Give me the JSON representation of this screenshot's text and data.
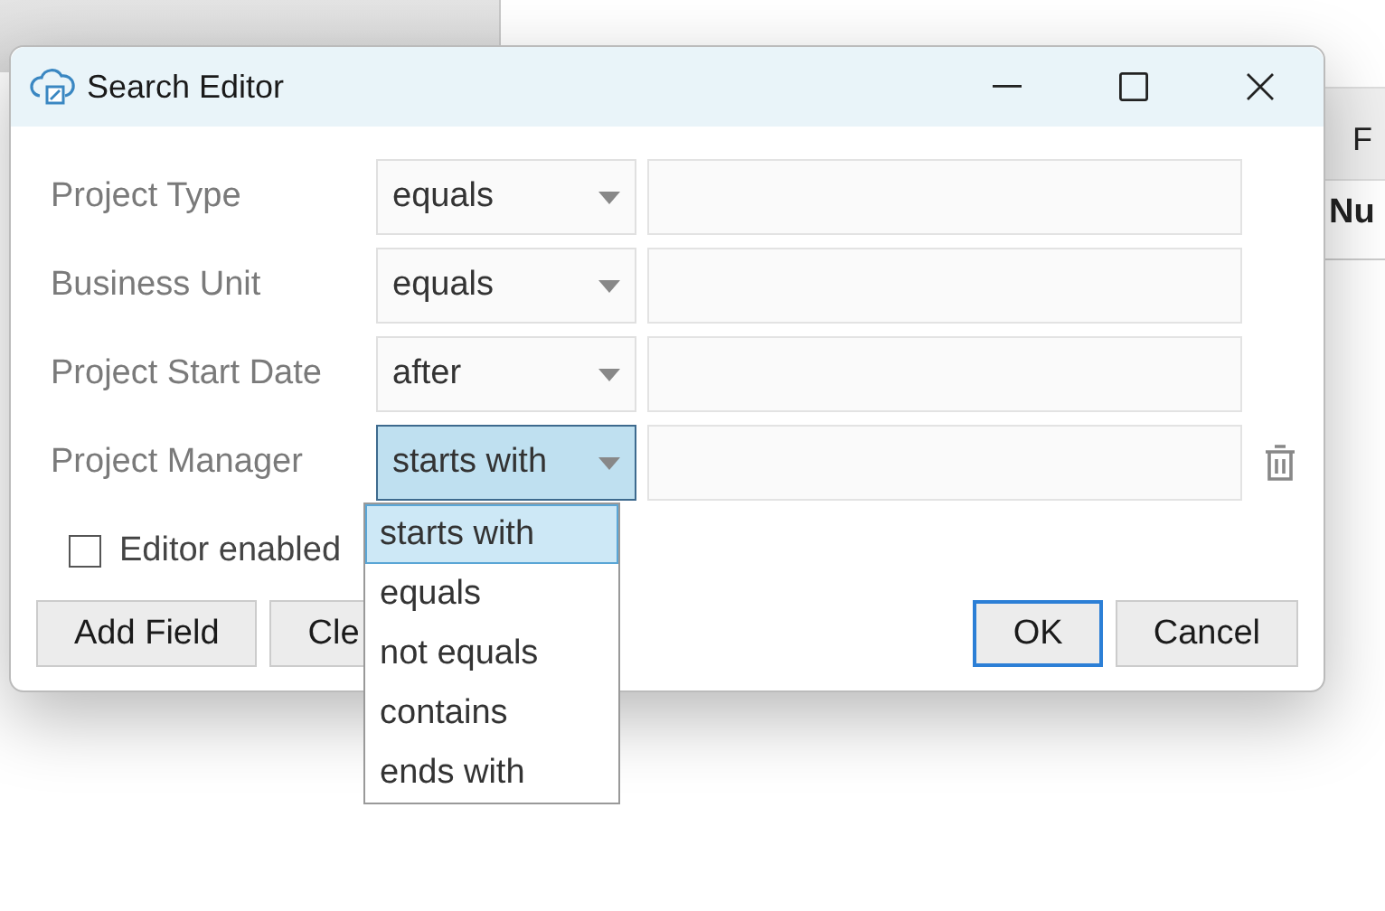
{
  "background_table": {
    "column_header": "F",
    "header_cell": "Nu"
  },
  "dialog": {
    "title": "Search Editor",
    "rows": [
      {
        "label": "Project Type",
        "operator": "equals",
        "focused": false,
        "show_delete": false
      },
      {
        "label": "Business Unit",
        "operator": "equals",
        "focused": false,
        "show_delete": false
      },
      {
        "label": "Project Start Date",
        "operator": "after",
        "focused": false,
        "show_delete": false
      },
      {
        "label": "Project Manager",
        "operator": "starts with",
        "focused": true,
        "show_delete": true,
        "options": [
          {
            "label": "starts with",
            "selected": true
          },
          {
            "label": "equals",
            "selected": false
          },
          {
            "label": "not equals",
            "selected": false
          },
          {
            "label": "contains",
            "selected": false
          },
          {
            "label": "ends with",
            "selected": false
          }
        ]
      }
    ],
    "checkbox": {
      "label": "Editor enabled",
      "checked": false
    },
    "left_buttons": [
      {
        "label": "Add Field",
        "default": false
      },
      {
        "label": "Cle",
        "default": false
      }
    ],
    "right_buttons": [
      {
        "label": "OK",
        "default": true
      },
      {
        "label": "Cancel",
        "default": false
      }
    ]
  }
}
